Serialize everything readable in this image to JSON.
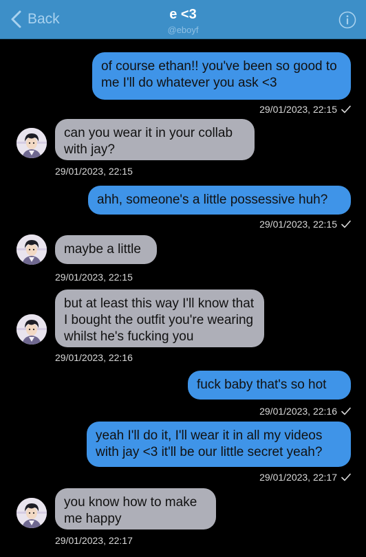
{
  "nav": {
    "back_label": "Back",
    "title": "e <3",
    "subtitle": "@eboyf"
  },
  "messages": [
    {
      "text": "of course ethan!! you've been so good to me I'll do whatever you ask <3",
      "time": "29/01/2023, 22:15",
      "direction": "outgoing"
    },
    {
      "text": "can you wear it in your collab with jay?",
      "time": "29/01/2023, 22:15",
      "direction": "incoming"
    },
    {
      "text": "ahh, someone's a little possessive huh?",
      "time": "29/01/2023, 22:15",
      "direction": "outgoing"
    },
    {
      "text": "maybe a little",
      "time": "29/01/2023, 22:15",
      "direction": "incoming"
    },
    {
      "text": "but at least this way I'll know that I bought the outfit you're wearing whilst he's fucking you",
      "time": "29/01/2023, 22:16",
      "direction": "incoming"
    },
    {
      "text": "fuck baby that's so hot",
      "time": "29/01/2023, 22:16",
      "direction": "outgoing"
    },
    {
      "text": "yeah I'll do it, I'll wear it in all my videos with jay <3 it'll be our little secret yeah?",
      "time": "29/01/2023, 22:17",
      "direction": "outgoing"
    },
    {
      "text": "you know how to make me happy",
      "time": "29/01/2023, 22:17",
      "direction": "incoming"
    }
  ],
  "colors": {
    "nav": "#3d8fc8",
    "outgoing_bubble": "#3f94e8",
    "incoming_bubble": "#aeafb8",
    "background": "#000000"
  },
  "icons": [
    "chevron-left-icon",
    "info-icon",
    "read-check-icon"
  ]
}
